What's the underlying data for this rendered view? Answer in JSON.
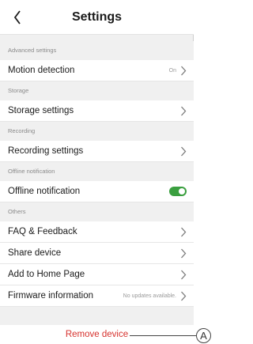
{
  "header": {
    "title": "Settings",
    "back_icon": "chevron-left-icon"
  },
  "sections": [
    {
      "label": "Advanced settings",
      "rows": [
        {
          "label": "Motion detection",
          "value": "On",
          "control": "chevron"
        }
      ]
    },
    {
      "label": "Storage",
      "rows": [
        {
          "label": "Storage settings",
          "value": "",
          "control": "chevron"
        }
      ]
    },
    {
      "label": "Recording",
      "rows": [
        {
          "label": "Recording settings",
          "value": "",
          "control": "chevron"
        }
      ]
    },
    {
      "label": "Offline notification",
      "rows": [
        {
          "label": "Offline notification",
          "value": "",
          "control": "toggle",
          "toggle_on": true
        }
      ]
    },
    {
      "label": "Others",
      "rows": [
        {
          "label": "FAQ & Feedback",
          "value": "",
          "control": "chevron"
        },
        {
          "label": "Share device",
          "value": "",
          "control": "chevron"
        },
        {
          "label": "Add to Home Page",
          "value": "",
          "control": "chevron"
        },
        {
          "label": "Firmware information",
          "value": "No updates available.",
          "control": "chevron"
        }
      ]
    }
  ],
  "remove_device": {
    "label": "Remove device"
  },
  "callout": {
    "letter": "A"
  },
  "colors": {
    "toggle_on": "#3a9f3f",
    "remove_text": "#d6322e",
    "background": "#f0f0f0"
  }
}
